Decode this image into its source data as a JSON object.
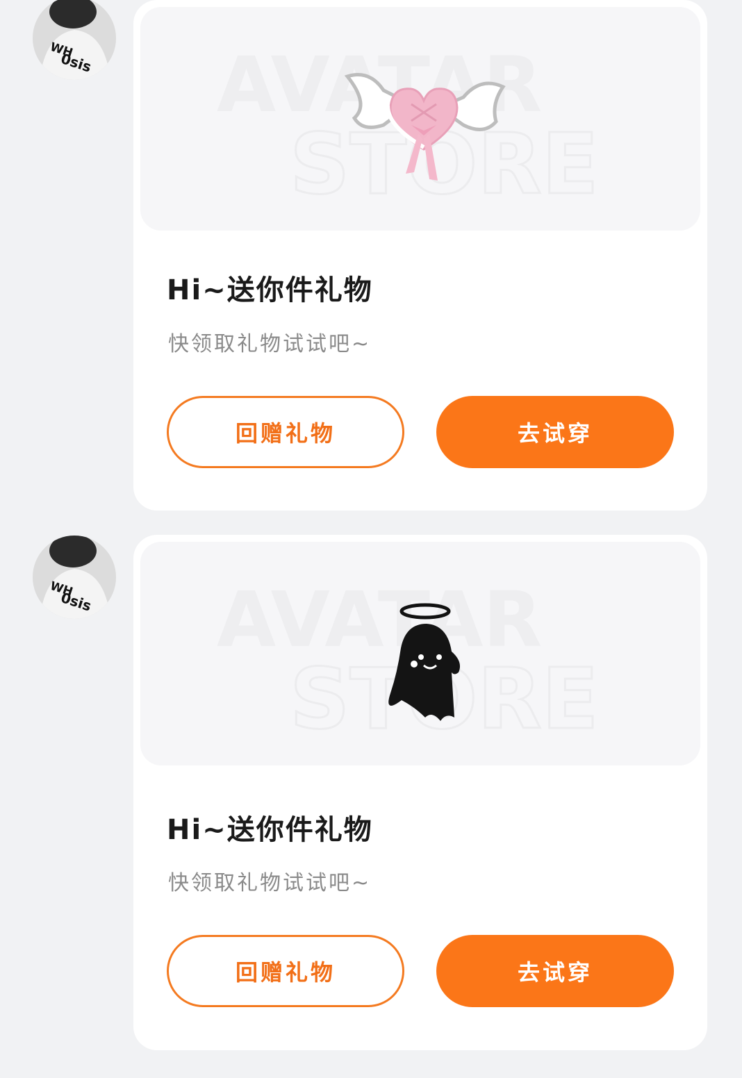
{
  "messages": [
    {
      "avatar_icon": "user-avatar-photo",
      "item_icon": "heart-bow-hair-accessory-icon",
      "watermark_line1": "AVATAR",
      "watermark_line2": "STORE",
      "title": "Hi~送你件礼物",
      "subtitle": "快领取礼物试试吧~",
      "return_gift_label": "回赠礼物",
      "try_on_label": "去试穿"
    },
    {
      "avatar_icon": "user-avatar-photo",
      "item_icon": "angel-ghost-icon",
      "watermark_line1": "AVATAR",
      "watermark_line2": "STORE",
      "title": "Hi~送你件礼物",
      "subtitle": "快领取礼物试试吧~",
      "return_gift_label": "回赠礼物",
      "try_on_label": "去试穿"
    }
  ],
  "colors": {
    "accent": "#fb7618",
    "accent_text": "#f26f17",
    "background": "#f1f2f4",
    "card": "#ffffff"
  }
}
